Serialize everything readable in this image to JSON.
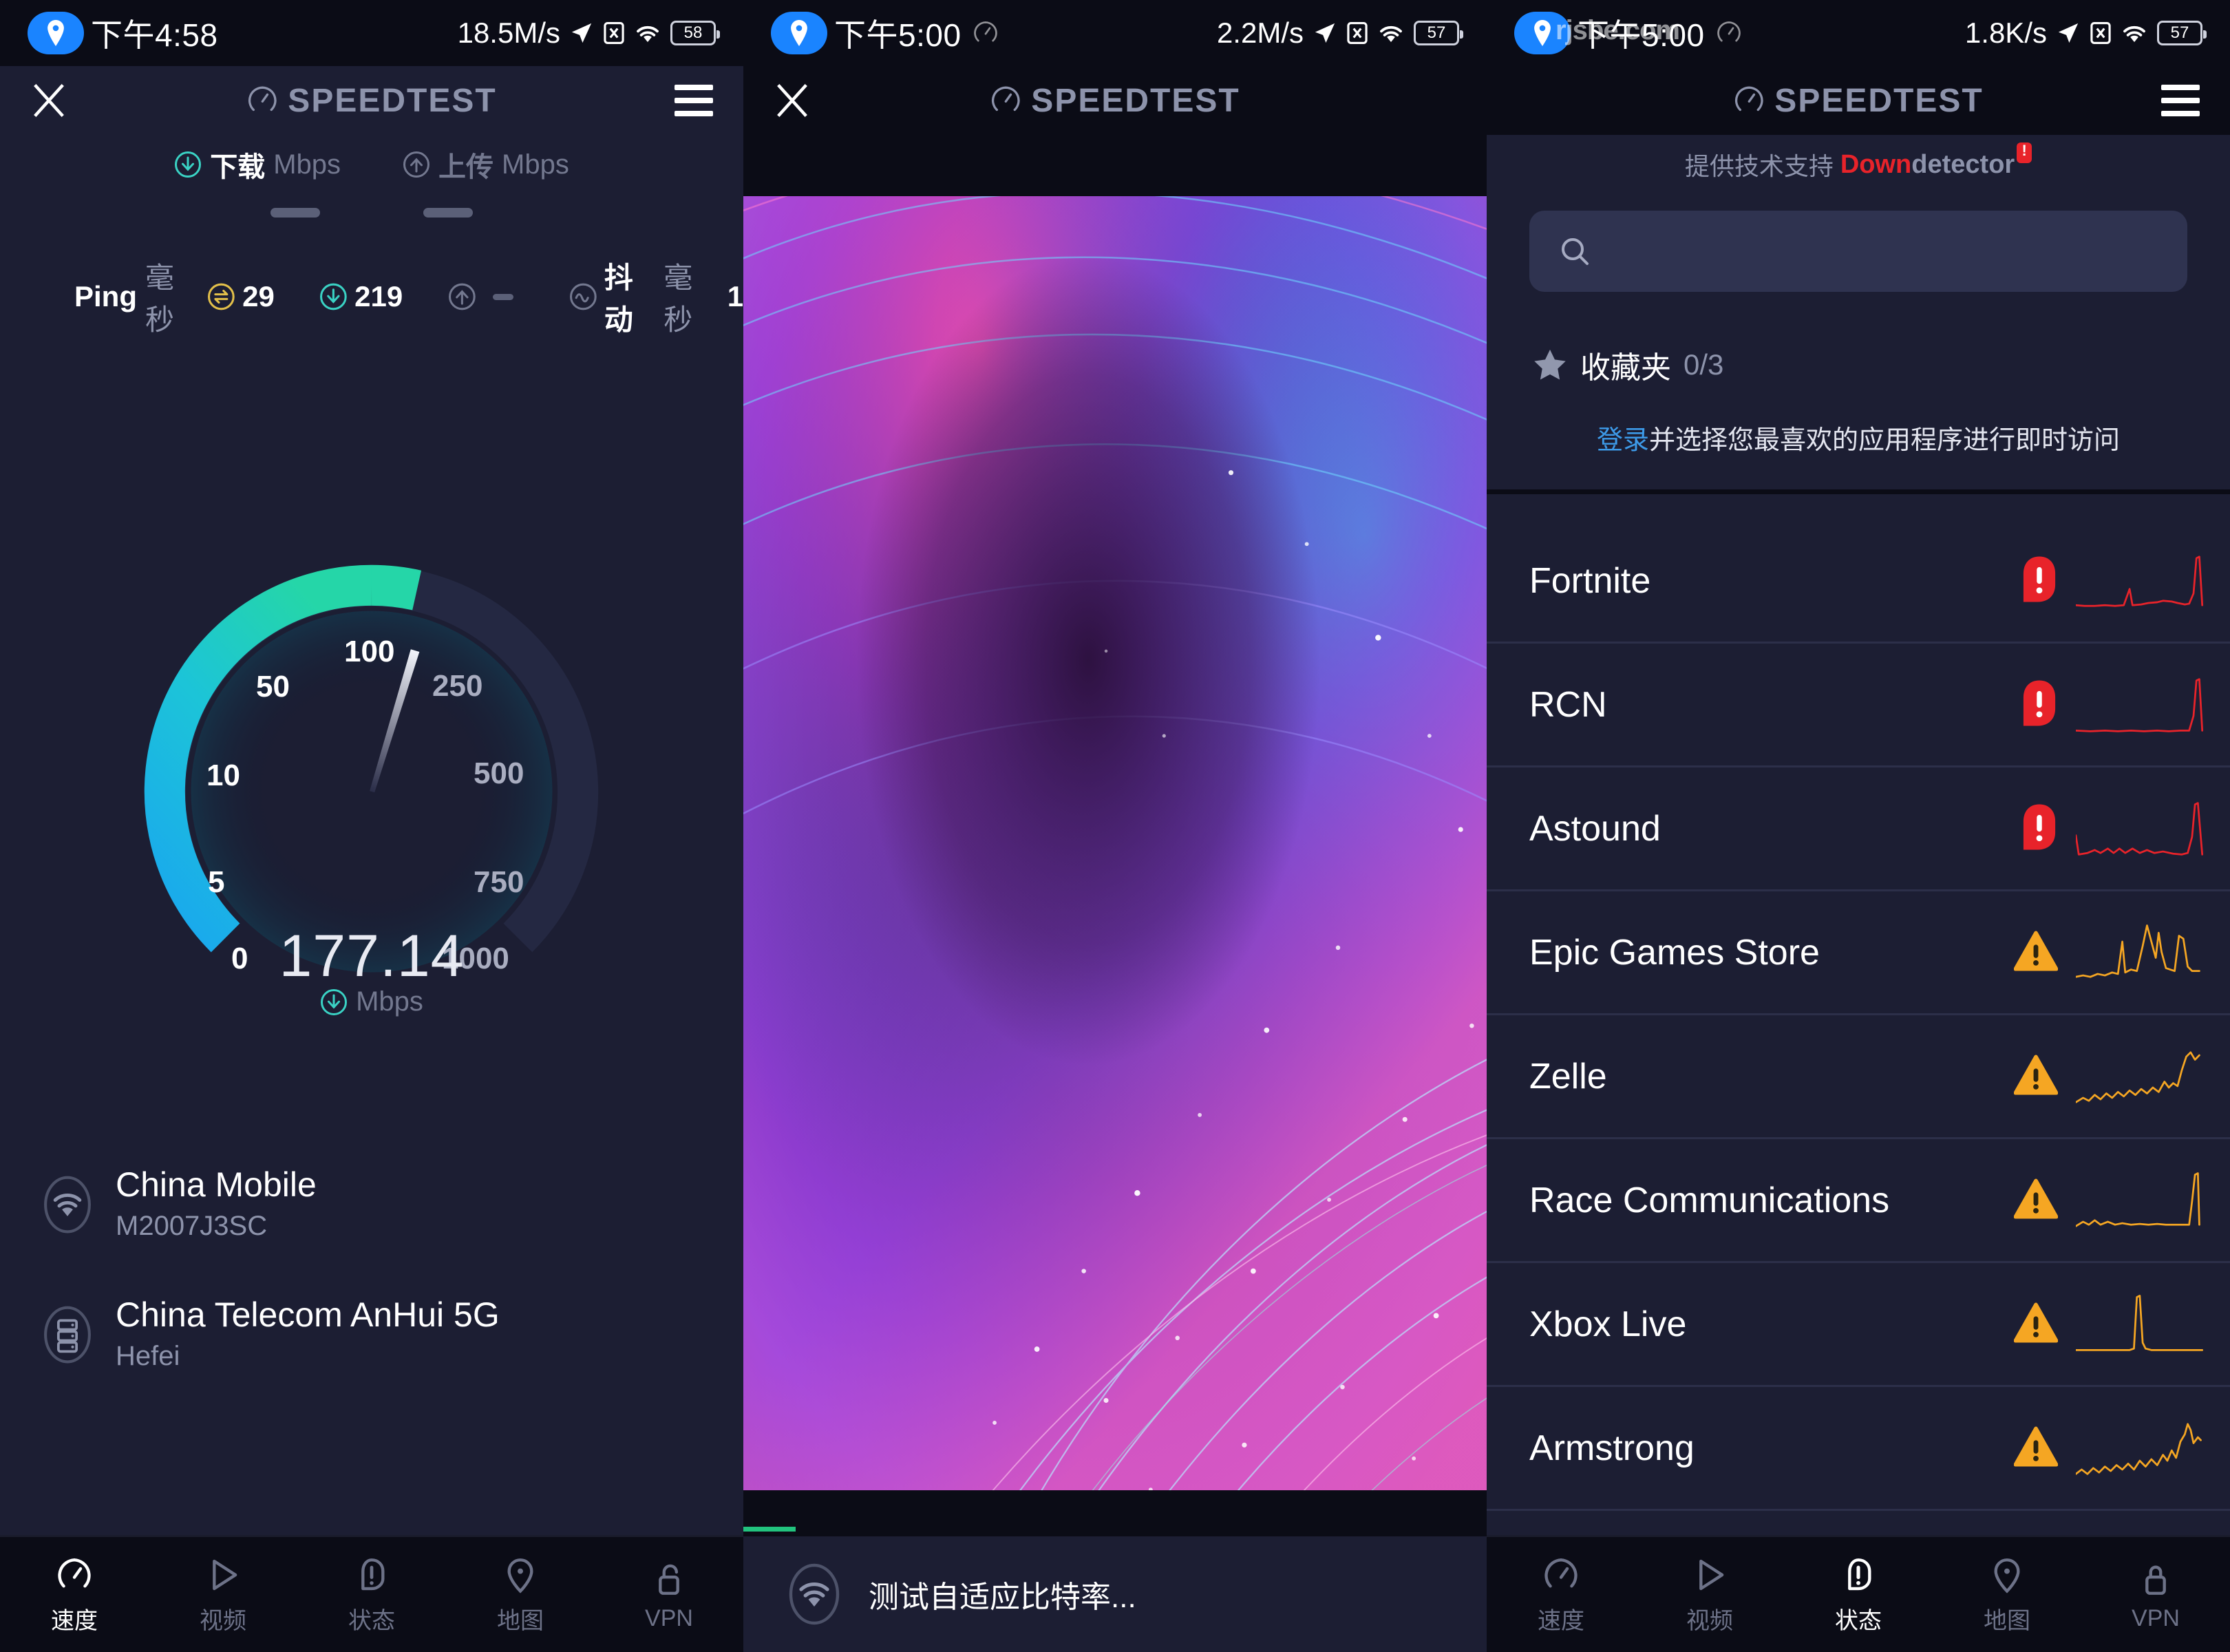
{
  "app": {
    "brand": "SPEEDTEST"
  },
  "panel1": {
    "statusbar": {
      "time": "下午4:58",
      "net_speed": "18.5M/s",
      "battery": "58",
      "icons": [
        "location-pin-icon",
        "navigation-arrow-icon",
        "sim-x-icon",
        "wifi-icon",
        "battery-icon"
      ]
    },
    "meters": {
      "download_label": "下载",
      "download_unit": "Mbps",
      "upload_label": "上传",
      "upload_unit": "Mbps",
      "download_value": "—",
      "upload_value": "—"
    },
    "ping": {
      "label": "Ping",
      "unit": "毫秒",
      "value": "29",
      "down_value": "219",
      "up_value": "—",
      "jitter_label": "抖动",
      "jitter_unit": "毫秒",
      "jitter_value": "1"
    },
    "gauge": {
      "ticks": [
        "0",
        "5",
        "10",
        "50",
        "100",
        "250",
        "500",
        "750",
        "1000"
      ],
      "reading": "177.14",
      "reading_unit": "Mbps",
      "min": 0,
      "max": 1000,
      "needle_value": 177.14,
      "arc_fill_pct": 57
    },
    "connection": {
      "isp": "China Mobile",
      "device": "M2007J3SC",
      "server": "China Telecom AnHui 5G",
      "city": "Hefei"
    },
    "nav": [
      {
        "label": "速度",
        "icon": "speed-gauge-icon",
        "active": true
      },
      {
        "label": "视频",
        "icon": "play-triangle-icon",
        "active": false
      },
      {
        "label": "状态",
        "icon": "status-alert-icon",
        "active": false
      },
      {
        "label": "地图",
        "icon": "map-pin-icon",
        "active": false
      },
      {
        "label": "VPN",
        "icon": "unlock-icon",
        "active": false
      }
    ]
  },
  "panel2": {
    "statusbar": {
      "time": "下午5:00",
      "net_speed": "2.2M/s",
      "battery": "57"
    },
    "status_text": "测试自适应比特率...",
    "progress_pct": 7,
    "progress_color": "#22c37e",
    "video_icon": "wifi-icon"
  },
  "panel3": {
    "statusbar": {
      "time": "下午5:00",
      "net_speed": "1.8K/s",
      "battery": "57"
    },
    "watermark": "rjsbe.com",
    "powered_by": {
      "prefix": "提供技术支持",
      "brand_red": "Down",
      "brand_grey": "detector"
    },
    "search": {
      "value": "",
      "placeholder": ""
    },
    "favorites": {
      "label": "收藏夹",
      "count": "0/3"
    },
    "signin": {
      "link": "登录",
      "text": "并选择您最喜欢的应用程序进行即时访问"
    },
    "services": [
      {
        "name": "Fortnite",
        "status": "error",
        "spark": "0,78 12,79 26,79 40,78 54,79 66,78 74,56 78,78 90,77 100,75 112,74 120,72 132,73 140,75 150,77 156,76 162,62 166,14 170,12 174,78"
      },
      {
        "name": "RCN",
        "status": "error",
        "spark": "0,80 20,81 40,80 58,81 76,80 94,81 112,80 128,81 144,80 156,80 162,60 166,12 170,10 174,80"
      },
      {
        "name": "Astound",
        "status": "error",
        "spark": "0,54 4,80 16,78 26,74 34,78 44,72 52,78 60,72 68,78 78,72 88,78 98,74 108,78 120,76 134,79 146,80 154,78 160,56 164,12 168,10 174,80"
      },
      {
        "name": "Epic Games Store",
        "status": "warning",
        "spark": "0,78 10,76 20,78 30,74 40,76 50,72 58,74 64,30 68,72 76,68 84,70 92,36 98,8 104,30 110,52 114,18 118,44 124,66 130,68 136,70 142,22 148,26 154,64 160,70 170,70"
      },
      {
        "name": "Zelle",
        "status": "warning",
        "spark": "0,80 10,74 18,78 26,70 34,76 42,68 50,74 58,66 66,72 74,64 82,70 90,62 98,68 106,60 114,66 122,52 128,60 134,54 140,58 146,36 152,18 158,12 164,22 170,16"
      },
      {
        "name": "Race Communications",
        "status": "warning",
        "spark": "0,80 10,74 18,78 26,72 34,78 44,74 54,78 64,76 76,78 88,77 100,78 112,77 124,78 136,78 148,78 156,78 160,46 164,10 168,8 170,78"
      },
      {
        "name": "Xbox Live",
        "status": "warning",
        "spark": "0,80 20,80 40,80 60,80 74,80 80,78 84,8 88,6 92,70 96,78 104,80 124,80 144,80 164,80 174,80"
      },
      {
        "name": "Armstrong",
        "status": "warning",
        "spark": "0,80 8,74 16,80 24,72 32,78 40,70 48,76 56,68 64,74 72,66 80,74 88,62 96,70 104,60 112,68 120,54 126,62 132,48 138,58 144,36 150,26 154,12 158,20 162,38 168,30 172,34"
      }
    ],
    "status_colors": {
      "error": "#e8232a",
      "warning": "#f5a623"
    },
    "nav": [
      {
        "label": "速度",
        "icon": "speed-gauge-icon",
        "active": false
      },
      {
        "label": "视频",
        "icon": "play-triangle-icon",
        "active": false
      },
      {
        "label": "状态",
        "icon": "status-alert-icon",
        "active": true
      },
      {
        "label": "地图",
        "icon": "map-pin-icon",
        "active": false
      },
      {
        "label": "VPN",
        "icon": "lock-icon",
        "active": false
      }
    ]
  }
}
